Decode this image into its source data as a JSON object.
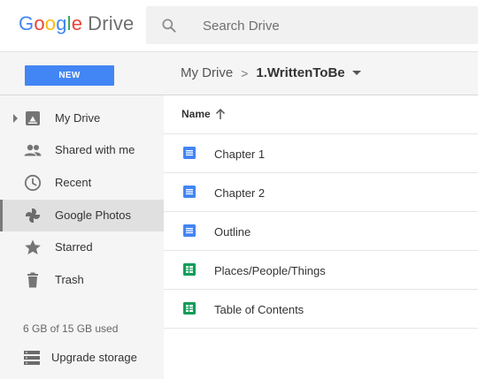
{
  "app": {
    "logo": {
      "brand": "Google",
      "product": "Drive"
    }
  },
  "search": {
    "placeholder": "Search Drive",
    "value": "",
    "icon": "search-icon"
  },
  "toolbar": {
    "new_label": "NEW",
    "accent": "#4285f4",
    "breadcrumb": {
      "root": "My Drive",
      "separator": ">",
      "current": "1.WrittenToBe"
    }
  },
  "sidebar": {
    "items": [
      {
        "label": "My Drive",
        "icon": "my-drive-icon",
        "expandable": true,
        "active": false
      },
      {
        "label": "Shared with me",
        "icon": "people-icon",
        "active": false
      },
      {
        "label": "Recent",
        "icon": "clock-icon",
        "active": false
      },
      {
        "label": "Google Photos",
        "icon": "photos-pinwheel-icon",
        "active": true
      },
      {
        "label": "Starred",
        "icon": "star-icon",
        "active": false
      },
      {
        "label": "Trash",
        "icon": "trash-icon",
        "active": false
      }
    ],
    "storage_text": "6 GB of 15 GB used",
    "upgrade_label": "Upgrade storage"
  },
  "files": {
    "column_header": "Name",
    "sort": "ascending",
    "rows": [
      {
        "name": "Chapter 1",
        "type": "document",
        "icon_color": "#4285f4"
      },
      {
        "name": "Chapter 2",
        "type": "document",
        "icon_color": "#4285f4"
      },
      {
        "name": "Outline",
        "type": "document",
        "icon_color": "#4285f4"
      },
      {
        "name": "Places/People/Things",
        "type": "spreadsheet",
        "icon_color": "#0f9d58"
      },
      {
        "name": "Table of Contents",
        "type": "spreadsheet",
        "icon_color": "#0f9d58"
      }
    ]
  }
}
